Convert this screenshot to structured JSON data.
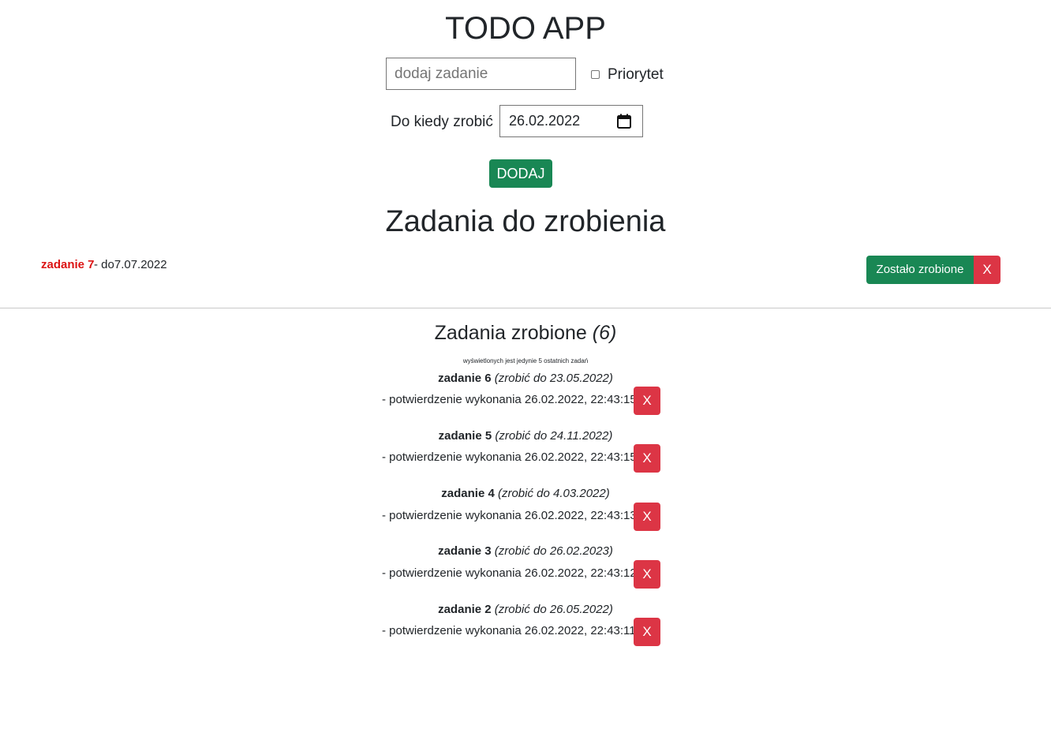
{
  "app": {
    "title": "TODO APP"
  },
  "form": {
    "task_placeholder": "dodaj zadanie",
    "priority_label": "Priorytet",
    "priority_checked": false,
    "deadline_label": "Do kiedy zrobić",
    "deadline_value": "26.02.2022",
    "add_button": "DODAJ"
  },
  "todo": {
    "heading": "Zadania do zrobienia",
    "items": [
      {
        "name": "zadanie 7",
        "deadline": "- do7.07.2022",
        "done_button": "Zostało zrobione",
        "delete_button": "X"
      }
    ]
  },
  "done": {
    "heading": "Zadania zrobione",
    "count": "(6)",
    "note": "wyświetlonych jest jedynie 5 ostatnich zadań",
    "items": [
      {
        "name": "zadanie 6",
        "deadline": "(zrobić do 23.05.2022)",
        "confirmation": "- potwierdzenie wykonania 26.02.2022, 22:43:15",
        "delete_button": "X"
      },
      {
        "name": "zadanie 5",
        "deadline": "(zrobić do 24.11.2022)",
        "confirmation": "- potwierdzenie wykonania 26.02.2022, 22:43:15",
        "delete_button": "X"
      },
      {
        "name": "zadanie 4",
        "deadline": "(zrobić do 4.03.2022)",
        "confirmation": "- potwierdzenie wykonania 26.02.2022, 22:43:13",
        "delete_button": "X"
      },
      {
        "name": "zadanie 3",
        "deadline": "(zrobić do 26.02.2023)",
        "confirmation": "- potwierdzenie wykonania 26.02.2022, 22:43:12",
        "delete_button": "X"
      },
      {
        "name": "zadanie 2",
        "deadline": "(zrobić do 26.05.2022)",
        "confirmation": "- potwierdzenie wykonania 26.02.2022, 22:43:11",
        "delete_button": "X"
      }
    ]
  },
  "colors": {
    "success": "#198754",
    "danger": "#dc3545",
    "priority_text": "#dc1414"
  }
}
